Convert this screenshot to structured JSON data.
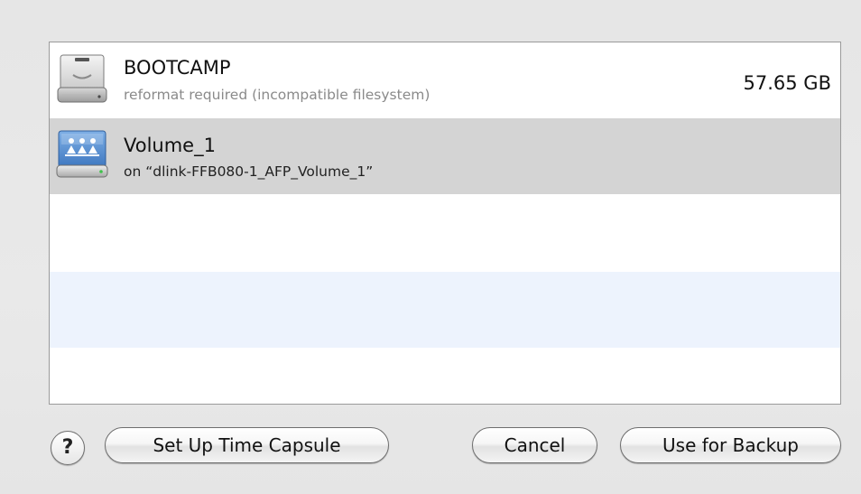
{
  "volumes": [
    {
      "name": "BOOTCAMP",
      "subtitle": "reformat required (incompatible filesystem)",
      "size": "57.65 GB",
      "icon": "hard-drive-icon",
      "selected": false
    },
    {
      "name": "Volume_1",
      "subtitle": "on “dlink-FFB080-1_AFP_Volume_1”",
      "size": "",
      "icon": "network-volume-icon",
      "selected": true
    }
  ],
  "buttons": {
    "help": "?",
    "setup_time_capsule": "Set Up Time Capsule",
    "cancel": "Cancel",
    "use_for_backup": "Use for Backup"
  },
  "colors": {
    "selected_row": "#d4d4d4",
    "alt_row": "#edf3fd",
    "subtitle_gray": "#8a8a8a"
  }
}
